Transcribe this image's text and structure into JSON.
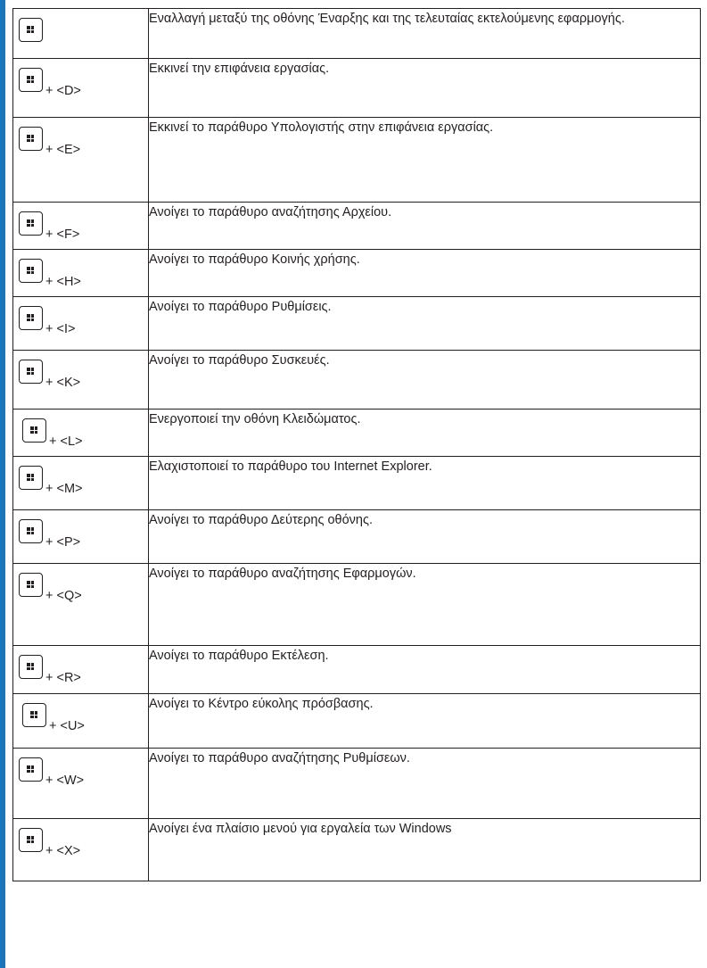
{
  "rows": [
    {
      "key": "",
      "description": "Εναλλαγή μεταξύ της οθόνης Έναρξης και της τελευταίας εκτελούμενης εφαρμογής."
    },
    {
      "key": "+ <D>",
      "description": "Εκκινεί την επιφάνεια εργασίας."
    },
    {
      "key": "+ <E>",
      "description": "Εκκινεί το παράθυρο Υπολογιστής στην επιφάνεια εργασίας."
    },
    {
      "key": "+ <F>",
      "description": "Ανοίγει το παράθυρο αναζήτησης Αρχείου."
    },
    {
      "key": "+ <H>",
      "description": "Ανοίγει το παράθυρο Κοινής χρήσης."
    },
    {
      "key": "+ <I>",
      "description": "Ανοίγει το παράθυρο Ρυθμίσεις."
    },
    {
      "key": "+ <K>",
      "description": "Ανοίγει το παράθυρο Συσκευές."
    },
    {
      "key": "+ <L>",
      "description": "Ενεργοποιεί την οθόνη Κλειδώματος."
    },
    {
      "key": "+ <M>",
      "description": "Ελαχιστοποιεί το παράθυρο του Internet Explorer."
    },
    {
      "key": "+ <P>",
      "description": "Ανοίγει το παράθυρο Δεύτερης οθόνης."
    },
    {
      "key": "+ <Q>",
      "description": "Ανοίγει το παράθυρο αναζήτησης Εφαρμογών."
    },
    {
      "key": "+ <R>",
      "description": "Ανοίγει το παράθυρο Εκτέλεση."
    },
    {
      "key": "+ <U>",
      "description": "Ανοίγει το Κέντρο εύκολης πρόσβασης."
    },
    {
      "key": "+ <W>",
      "description": "Ανοίγει το παράθυρο αναζήτησης Ρυθμίσεων."
    },
    {
      "key": "+ <X>",
      "description": "Ανοίγει ένα πλαίσιο μενού για εργαλεία των Windows"
    }
  ],
  "colors": {
    "accent_bar": "#1b75bc",
    "text": "#231f20"
  },
  "icons": {
    "key_icon": "windows-key-icon"
  }
}
